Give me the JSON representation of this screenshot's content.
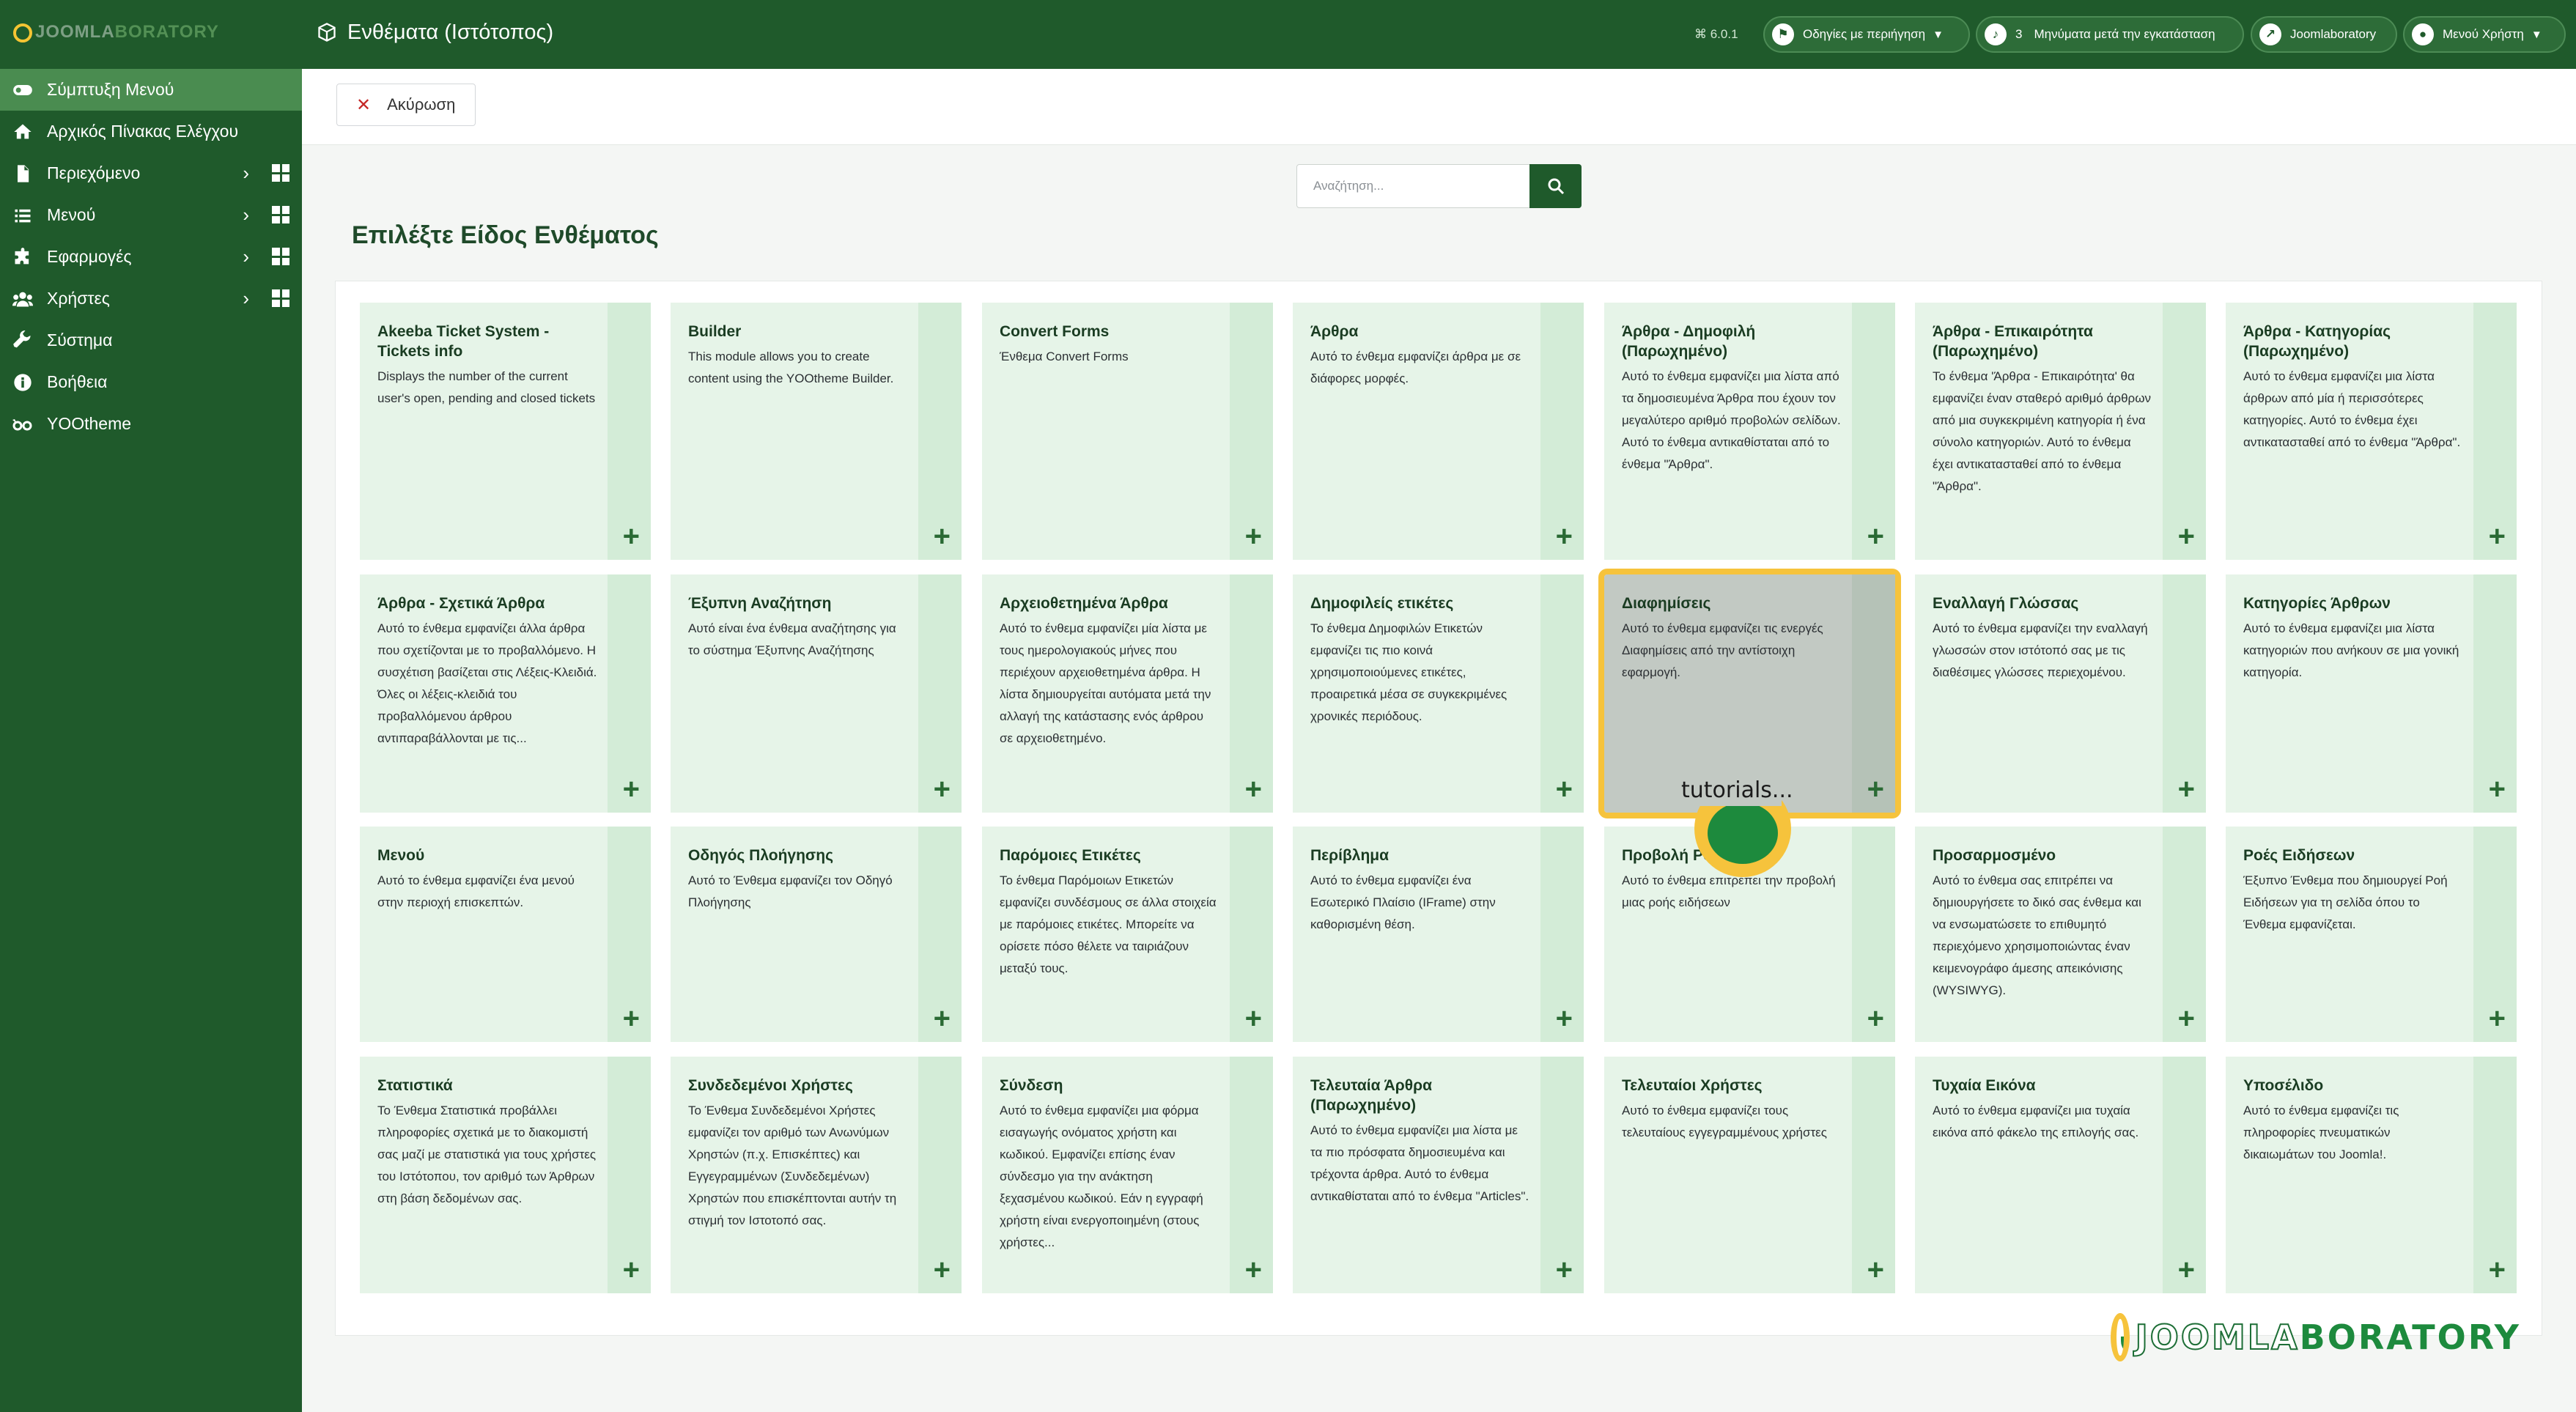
{
  "brand": {
    "logo_prefix": "JOOMLA",
    "logo_suffix": "BORATORY"
  },
  "sidebar": {
    "items": [
      {
        "label": "Σύμπτυξη Μενού",
        "icon": "toggle-icon"
      },
      {
        "label": "Αρχικός Πίνακας Ελέγχου",
        "icon": "home-icon"
      },
      {
        "label": "Περιεχόμενο",
        "icon": "file-icon",
        "submenu": true
      },
      {
        "label": "Μενού",
        "icon": "list-icon",
        "submenu": true
      },
      {
        "label": "Εφαρμογές",
        "icon": "puzzle-icon",
        "submenu": true
      },
      {
        "label": "Χρήστες",
        "icon": "users-icon",
        "submenu": true
      },
      {
        "label": "Σύστημα",
        "icon": "wrench-icon"
      },
      {
        "label": "Βοήθεια",
        "icon": "info-icon"
      },
      {
        "label": "YOOtheme",
        "icon": "yootheme-icon"
      }
    ]
  },
  "header": {
    "title": "Ενθέματα (Ιστότοπος)",
    "version": "⌘ 6.0.1",
    "guided_tours": "Οδηγίες με περιήγηση",
    "notifications_count": "3",
    "post_install": "Μηνύματα μετά την εγκατάσταση",
    "site_link": "Joomlaboratory",
    "user_menu": "Μενού Χρήστη"
  },
  "toolbar": {
    "cancel_label": "Ακύρωση"
  },
  "search": {
    "placeholder": "Αναζήτηση...",
    "value": ""
  },
  "main": {
    "title": "Επιλέξτε Είδος Ενθέματος"
  },
  "modules": [
    {
      "title": "Akeeba Ticket System - Tickets info",
      "desc": "Displays the number of the current user's open, pending and closed tickets"
    },
    {
      "title": "Builder",
      "desc": "This module allows you to create content using the YOOtheme Builder."
    },
    {
      "title": "Convert Forms",
      "desc": "Ένθεμα Convert Forms"
    },
    {
      "title": "Άρθρα",
      "desc": "Αυτό το ένθεμα εμφανίζει άρθρα με σε διάφορες μορφές."
    },
    {
      "title": "Άρθρα - Δημοφιλή (Παρωχημένο)",
      "desc": "Αυτό το ένθεμα εμφανίζει μια λίστα από τα δημοσιευμένα Άρθρα που έχουν τον μεγαλύτερο αριθμό προβολών σελίδων. Αυτό το ένθεμα αντικαθίσταται από το ένθεμα \"Άρθρα\"."
    },
    {
      "title": "Άρθρα - Επικαιρότητα (Παρωχημένο)",
      "desc": "Το ένθεμα 'Άρθρα - Επικαιρότητα' θα εμφανίζει έναν σταθερό αριθμό άρθρων από μια συγκεκριμένη κατηγορία ή ένα σύνολο κατηγοριών. Αυτό το ένθεμα έχει αντικατασταθεί από το ένθεμα \"Άρθρα\"."
    },
    {
      "title": "Άρθρα - Κατηγορίας (Παρωχημένο)",
      "desc": "Αυτό το ένθεμα εμφανίζει μια λίστα άρθρων από μία ή περισσότερες κατηγορίες. Αυτό το ένθεμα έχει αντικατασταθεί από το ένθεμα \"Άρθρα\"."
    },
    {
      "title": "Άρθρα - Σχετικά Άρθρα",
      "desc": "Αυτό το ένθεμα εμφανίζει άλλα άρθρα που σχετίζονται με το προβαλλόμενο. Η συσχέτιση βασίζεται στις Λέξεις-Κλειδιά. Όλες οι λέξεις-κλειδιά του προβαλλόμενου άρθρου αντιπαραβάλλονται με τις..."
    },
    {
      "title": "Έξυπνη Αναζήτηση",
      "desc": "Αυτό είναι ένα ένθεμα αναζήτησης για το σύστημα Έξυπνης Αναζήτησης"
    },
    {
      "title": "Αρχειοθετημένα Άρθρα",
      "desc": "Αυτό το ένθεμα εμφανίζει μία λίστα με τους ημερολογιακούς μήνες που περιέχουν αρχειοθετημένα άρθρα. Η λίστα δημιουργείται αυτόματα μετά την αλλαγή της κατάστασης ενός άρθρου σε αρχειοθετημένο."
    },
    {
      "title": "Δημοφιλείς ετικέτες",
      "desc": "Το ένθεμα Δημοφιλών Ετικετών εμφανίζει τις πιο κοινά χρησιμοποιούμενες ετικέτες, προαιρετικά μέσα σε συγκεκριμένες χρονικές περιόδους."
    },
    {
      "title": "Διαφημίσεις",
      "desc": "Αυτό το ένθεμα εμφανίζει τις ενεργές Διαφημίσεις από την αντίστοιχη εφαρμογή."
    },
    {
      "title": "Εναλλαγή Γλώσσας",
      "desc": "Αυτό το ένθεμα εμφανίζει την εναλλαγή γλωσσών στον ιστότοπό σας με τις διαθέσιμες γλώσσες περιεχομένου."
    },
    {
      "title": "Κατηγορίες Άρθρων",
      "desc": "Αυτό το ένθεμα εμφανίζει μια λίστα κατηγοριών που ανήκουν σε μια γονική κατηγορία."
    },
    {
      "title": "Μενού",
      "desc": "Αυτό το ένθεμα εμφανίζει ένα μενού στην περιοχή επισκεπτών."
    },
    {
      "title": "Οδηγός Πλοήγησης",
      "desc": "Αυτό το Ένθεμα εμφανίζει τον Οδηγό Πλοήγησης"
    },
    {
      "title": "Παρόμοιες Ετικέτες",
      "desc": "Το ένθεμα Παρόμοιων Ετικετών εμφανίζει συνδέσμους σε άλλα στοιχεία με παρόμοιες ετικέτες. Μπορείτε να ορίσετε πόσο θέλετε να ταιριάζουν μεταξύ τους."
    },
    {
      "title": "Περίβλημα",
      "desc": "Αυτό το ένθεμα εμφανίζει ένα Εσωτερικό Πλαίσιο (IFrame) στην καθορισμένη θέση."
    },
    {
      "title": "Προβολή Ροής",
      "desc": "Αυτό το ένθεμα επιτρέπει την προβολή μιας ροής ειδήσεων"
    },
    {
      "title": "Προσαρμοσμένο",
      "desc": "Αυτό το ένθεμα σας επιτρέπει να δημιουργήσετε το δικό σας ένθεμα και να ενσωματώσετε το επιθυμητό περιεχόμενο χρησιμοποιώντας έναν κειμενογράφο άμεσης απεικόνισης (WYSIWYG)."
    },
    {
      "title": "Ροές Ειδήσεων",
      "desc": "Έξυπνο Ένθεμα που δημιουργεί Ροή Ειδήσεων για τη σελίδα όπου το Ένθεμα εμφανίζεται."
    },
    {
      "title": "Στατιστικά",
      "desc": "Το Ένθεμα Στατιστικά προβάλλει πληροφορίες σχετικά με το διακομιστή σας μαζί με στατιστικά για τους χρήστες του Ιστότοπου, τον αριθμό των Άρθρων στη βάση δεδομένων σας."
    },
    {
      "title": "Συνδεδεμένοι Χρήστες",
      "desc": "Το Ένθεμα Συνδεδεμένοι Χρήστες εμφανίζει τον αριθμό των Ανωνύμων Χρηστών (π.χ. Επισκέπτες) και Εγγεγραμμένων (Συνδεδεμένων) Χρηστών που επισκέπτονται αυτήν τη στιγμή τον Ιστοτοπό σας."
    },
    {
      "title": "Σύνδεση",
      "desc": "Αυτό το ένθεμα εμφανίζει μια φόρμα εισαγωγής ονόματος χρήστη και κωδικού. Εμφανίζει επίσης έναν σύνδεσμο για την ανάκτηση ξεχασμένου κωδικού. Εάν η εγγραφή χρήστη είναι ενεργοποιημένη (στους χρήστες..."
    },
    {
      "title": "Τελευταία Άρθρα (Παρωχημένο)",
      "desc": "Αυτό το ένθεμα εμφανίζει μια λίστα με τα πιο πρόσφατα δημοσιευμένα και τρέχοντα άρθρα. Αυτό το ένθεμα αντικαθίσταται από το ένθεμα \"Articles\"."
    },
    {
      "title": "Τελευταίοι Χρήστες",
      "desc": "Αυτό το ένθεμα εμφανίζει τους τελευταίους εγγεγραμμένους χρήστες"
    },
    {
      "title": "Τυχαία Εικόνα",
      "desc": "Αυτό το ένθεμα εμφανίζει μια τυχαία εικόνα από φάκελο της επιλογής σας."
    },
    {
      "title": "Υποσέλιδο",
      "desc": "Αυτό το ένθεμα εμφανίζει τις πληροφορίες πνευματικών δικαιωμάτων του Joomla!."
    }
  ],
  "overlay": {
    "tooltip_label": "tutorials..."
  },
  "colors": {
    "primary": "#1f5a2b",
    "card_bg": "#e6f4e8",
    "highlight": "#f6c33c"
  }
}
